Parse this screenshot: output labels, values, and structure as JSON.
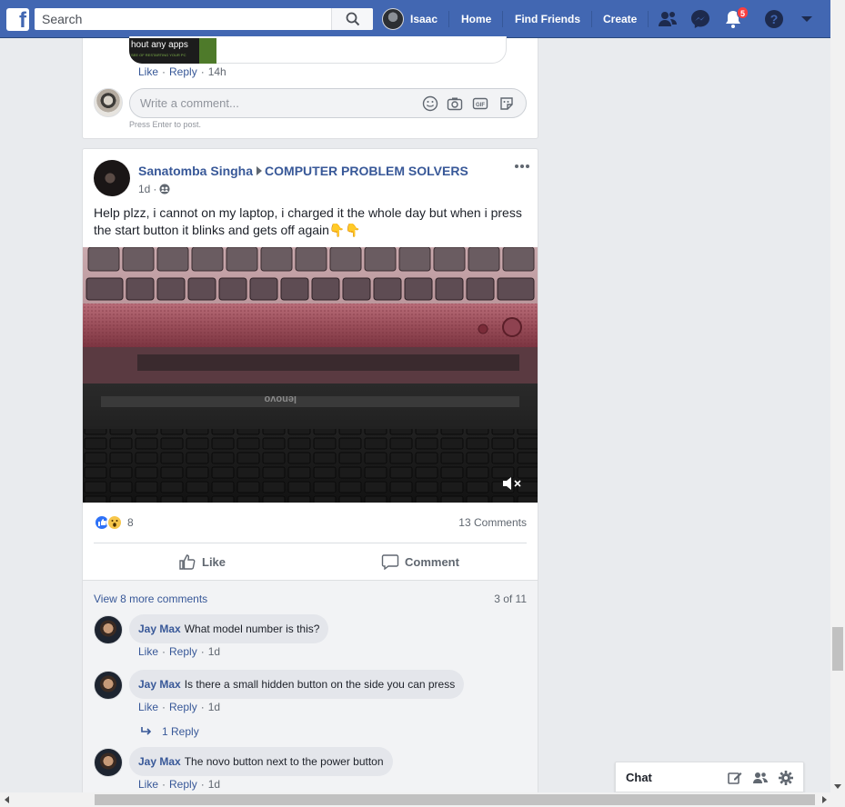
{
  "topbar": {
    "logo_letter": "f",
    "search_placeholder": "Search",
    "profile_name": "Isaac",
    "nav_links": [
      "Home",
      "Find Friends",
      "Create"
    ],
    "notifications_count": "5",
    "icons": [
      "friend-requests-icon",
      "messenger-icon",
      "notifications-icon",
      "help-icon",
      "account-menu-icon"
    ]
  },
  "previous_post": {
    "preview_text": "hout any apps",
    "preview_subtext": "SEE OF RESTARTING YOUR PC",
    "actions": {
      "like": "Like",
      "reply": "Reply",
      "time": "14h"
    },
    "comment_input_placeholder": "Write a comment...",
    "press_enter": "Press Enter to post."
  },
  "post": {
    "author": "Sanatomba Singha",
    "group": "COMPUTER PROBLEM SOLVERS",
    "time": "1d",
    "text": "Help plzz, i cannot on my laptop, i charged it the whole day but when i press the start button it blinks and gets off again👇👇",
    "reaction_count": "8",
    "comment_count": "13 Comments",
    "like_label": "Like",
    "comment_label": "Comment",
    "view_more": "View 8 more comments",
    "page_count": "3 of 11",
    "comments": [
      {
        "name": "Jay Max",
        "text": "What model number is this?",
        "like": "Like",
        "reply": "Reply",
        "time": "1d"
      },
      {
        "name": "Jay Max",
        "text": "Is there a small hidden button on the side you can press",
        "like": "Like",
        "reply": "Reply",
        "time": "1d"
      },
      {
        "name": "Jay Max",
        "text": "The novo button next to the power button",
        "like": "Like",
        "reply": "Reply",
        "time": "1d"
      }
    ],
    "replies_link": "1 Reply",
    "image_brand": "lenovo"
  },
  "chat": {
    "label": "Chat"
  },
  "colors": {
    "brand": "#4267b2",
    "link": "#385898",
    "badge": "#fa3e3e"
  }
}
